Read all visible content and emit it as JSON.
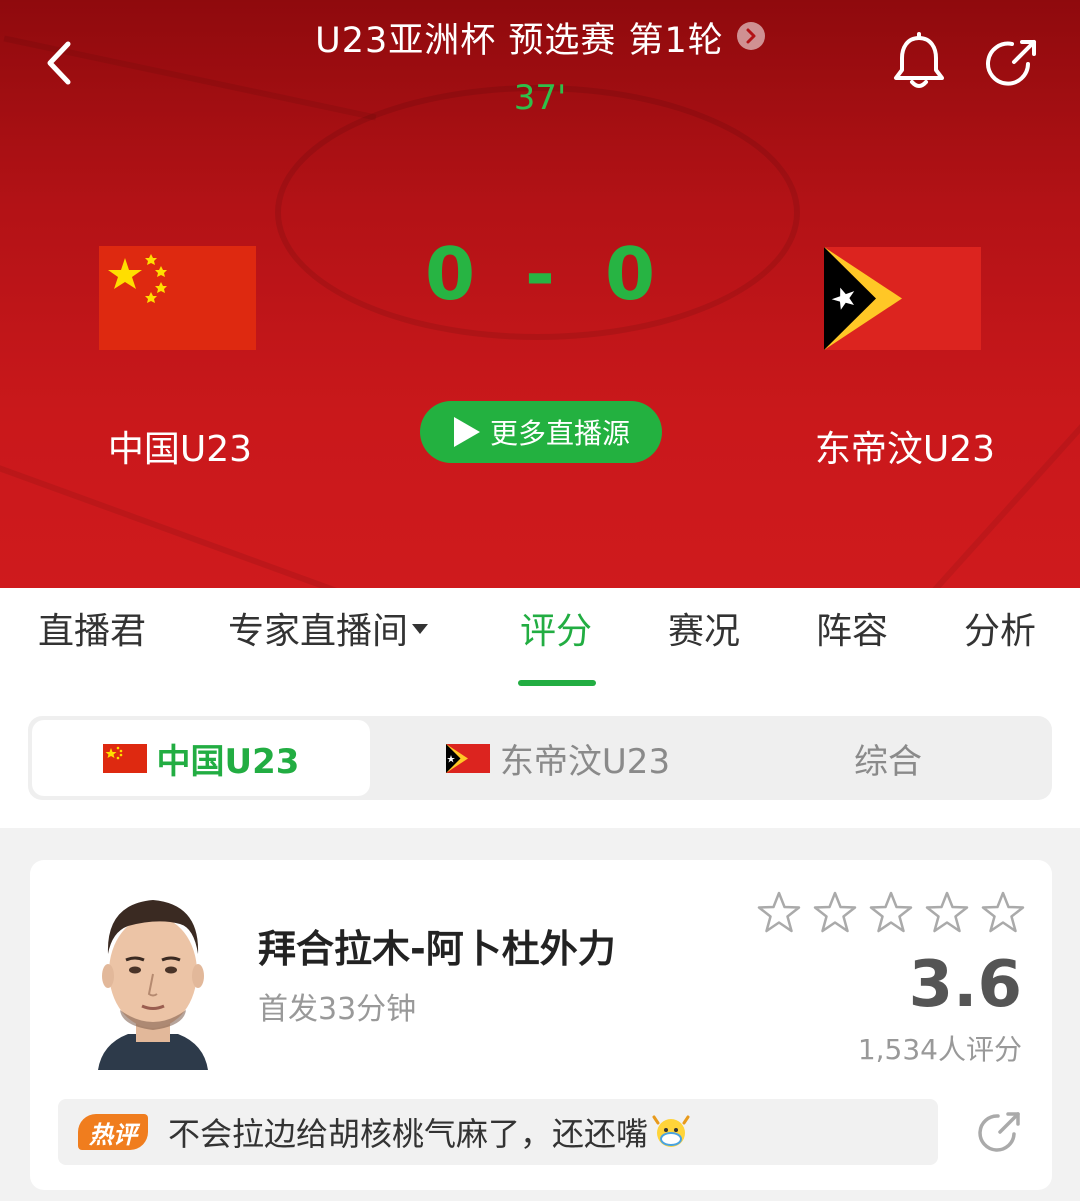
{
  "header": {
    "match_title": "U23亚洲杯 预选赛 第1轮",
    "minute": "37'",
    "icons": [
      "back-icon",
      "chevron-right-icon",
      "bell-icon",
      "share-icon"
    ]
  },
  "match": {
    "home": {
      "name": "中国U23",
      "score": "0",
      "flag": "china-flag"
    },
    "away": {
      "name": "东帝汶U23",
      "score": "0",
      "flag": "timor-leste-flag"
    },
    "score_separator": "-",
    "live_button_label": "更多直播源"
  },
  "tabs": [
    {
      "label": "直播君"
    },
    {
      "label": "专家直播间"
    },
    {
      "label": "评分",
      "active": true
    },
    {
      "label": "赛况"
    },
    {
      "label": "阵容"
    },
    {
      "label": "分析"
    }
  ],
  "segment": [
    {
      "label": "中国U23",
      "active": true
    },
    {
      "label": "东帝汶U23"
    },
    {
      "label": "综合"
    }
  ],
  "player": {
    "name": "拜合拉木-阿卜杜外力",
    "subtitle": "首发33分钟",
    "rating": "3.6",
    "rating_count": "1,534人评分",
    "stars_filled": 0,
    "stars_total": 5,
    "hot_badge": "热评",
    "hot_comment": "不会拉边给胡核桃气麻了，还还嘴"
  },
  "colors": {
    "accent_green": "#22ad42",
    "hero_red": "#c9181b",
    "hot_orange": "#f07d1e"
  }
}
